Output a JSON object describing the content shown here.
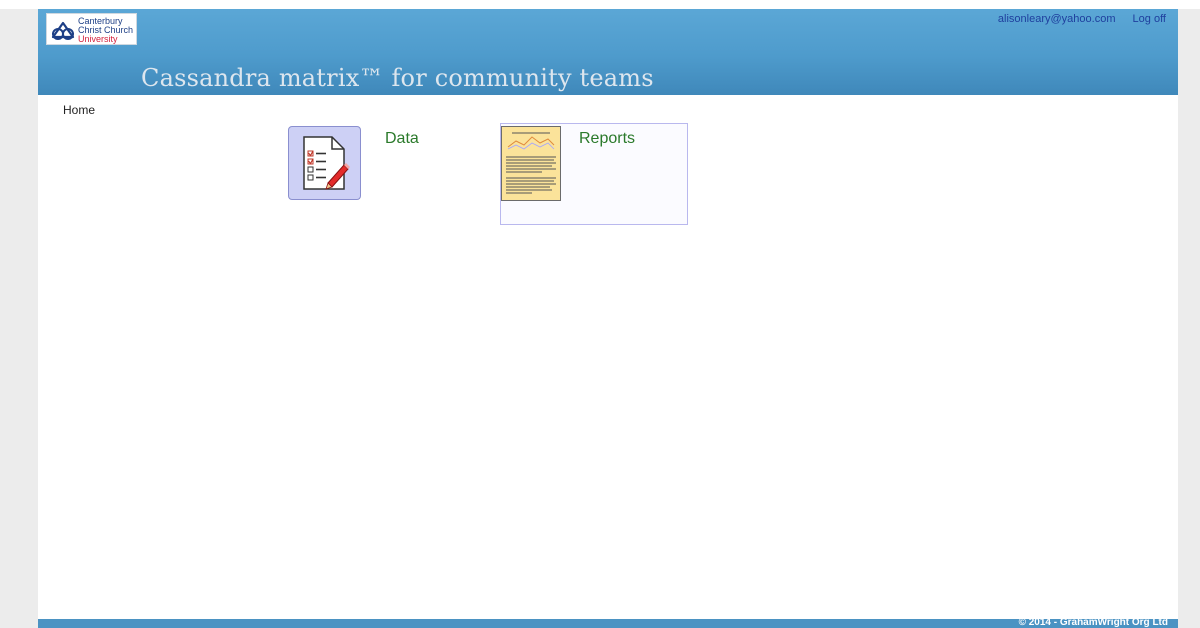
{
  "header": {
    "logo": {
      "line1": "Canterbury",
      "line2": "Christ Church",
      "line3": "University"
    },
    "user_email": "alisonleary@yahoo.com",
    "logoff_label": "Log off",
    "site_title": "Cassandra matrix™ for community teams"
  },
  "breadcrumb": "Home",
  "tiles": {
    "data_label": "Data",
    "reports_label": "Reports"
  },
  "footer": {
    "copyright": "© 2014 - GrahamWright Org Ltd"
  },
  "colors": {
    "header_blue": "#4e9bcc",
    "tile_label_green": "#2b7a2b",
    "data_tile_bg": "#cdd0f5",
    "reports_thumb_bg": "#fbe39a"
  },
  "icons": {
    "data": "checklist-pencil-icon",
    "reports": "report-thumbnail",
    "logo": "ccu-logo-icon"
  }
}
